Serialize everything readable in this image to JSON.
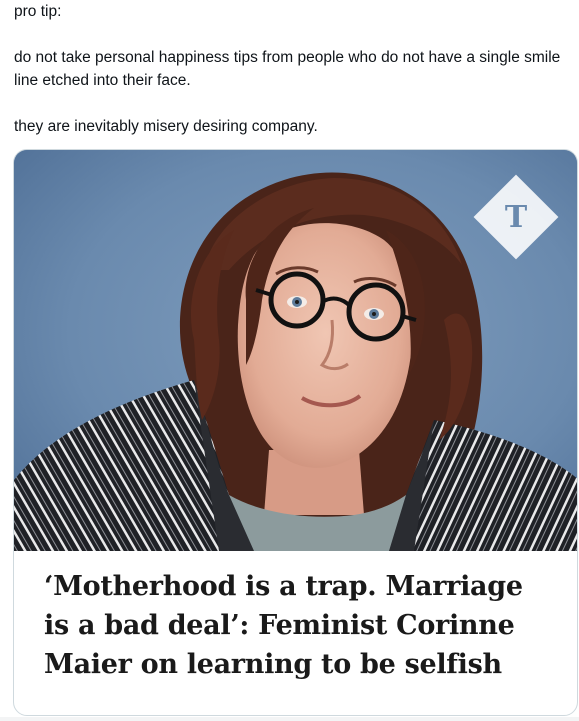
{
  "tweet": {
    "lines": [
      "pro tip:",
      "do not take personal happiness tips from people who do not have a single smile line etched into their face.",
      "they are inevitably misery desiring company."
    ]
  },
  "card": {
    "headline": "‘Motherhood is a trap. Marriage is a bad deal’: Feminist Corinne Maier on learning to be selfish",
    "publisher_logo": "telegraph-t-logo",
    "image_subject": "photo-of-woman-with-round-glasses"
  },
  "colors": {
    "background": "#ffffff",
    "text": "#0f1419",
    "card_border": "#cfd9de",
    "photo_backdrop": "#6d8db0",
    "headline": "#1a1a1a"
  }
}
